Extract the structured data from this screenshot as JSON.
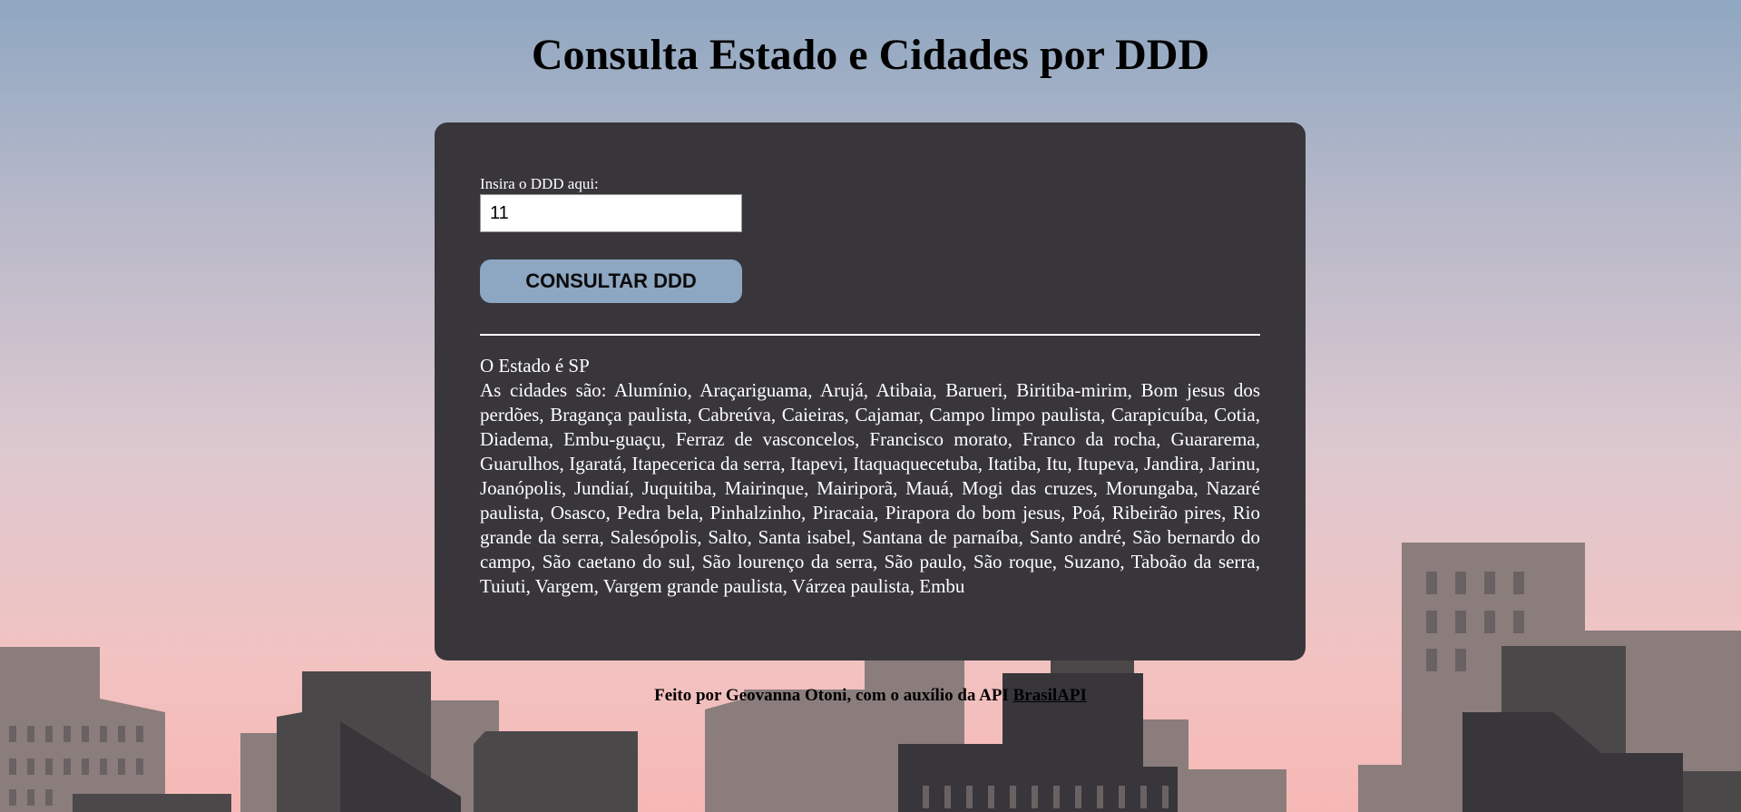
{
  "header": {
    "title": "Consulta Estado e Cidades por DDD"
  },
  "form": {
    "label": "Insira o DDD aqui:",
    "ddd_value": "11",
    "button_label": "CONSULTAR DDD"
  },
  "result": {
    "state_text": "O Estado é SP",
    "cities_text": "As cidades são: Alumínio, Araçariguama, Arujá, Atibaia, Barueri, Biritiba-mirim, Bom jesus dos perdões, Bragança paulista, Cabreúva, Caieiras, Cajamar, Campo limpo paulista, Carapicuíba, Cotia, Diadema, Embu-guaçu, Ferraz de vasconcelos, Francisco morato, Franco da rocha, Guararema, Guarulhos, Igaratá, Itapecerica da serra, Itapevi, Itaquaquecetuba, Itatiba, Itu, Itupeva, Jandira, Jarinu, Joanópolis, Jundiaí, Juquitiba, Mairinque, Mairiporã, Mauá, Mogi das cruzes, Morungaba, Nazaré paulista, Osasco, Pedra bela, Pinhalzinho, Piracaia, Pirapora do bom jesus, Poá, Ribeirão pires, Rio grande da serra, Salesópolis, Salto, Santa isabel, Santana de parnaíba, Santo andré, São bernardo do campo, São caetano do sul, São lourenço da serra, São paulo, São roque, Suzano, Taboão da serra, Tuiuti, Vargem, Vargem grande paulista, Várzea paulista, Embu"
  },
  "footer": {
    "text": "Feito por Geovanna Otoni, com o auxílio da API ",
    "link_label": "BrasilAPI"
  },
  "colors": {
    "card_background": "#38363a",
    "button_background": "#8da6c1",
    "sky_top": "#8fa7c1",
    "sky_bottom": "#f6b8b5"
  }
}
